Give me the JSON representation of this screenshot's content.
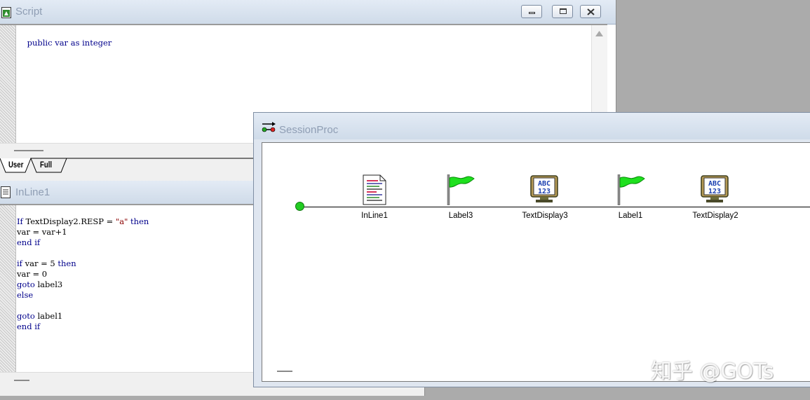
{
  "script_window": {
    "title": "Script",
    "code_line": "public var as integer",
    "tabs": [
      {
        "label": "User"
      },
      {
        "label": "Full"
      }
    ]
  },
  "inline_window": {
    "title": "InLine1",
    "code": [
      "If TextDisplay2.RESP = \"a\" then",
      "var = var+1",
      "end if",
      "",
      "if var = 5 then",
      "var = 0",
      "goto label3",
      "else",
      "",
      "goto label1",
      "end if"
    ]
  },
  "session_window": {
    "title": "SessionProc",
    "nodes": [
      {
        "label": "InLine1",
        "icon": "inline-script-icon"
      },
      {
        "label": "Label3",
        "icon": "green-flag-icon"
      },
      {
        "label": "TextDisplay3",
        "icon": "text-display-icon"
      },
      {
        "label": "Label1",
        "icon": "green-flag-icon"
      },
      {
        "label": "TextDisplay2",
        "icon": "text-display-icon"
      }
    ]
  },
  "watermark": "知乎 @GOTs",
  "colors": {
    "keyword": "#00008b",
    "string": "#8b0000",
    "timeline_start": "#22cc22",
    "title_text": "#8f9eb4"
  }
}
